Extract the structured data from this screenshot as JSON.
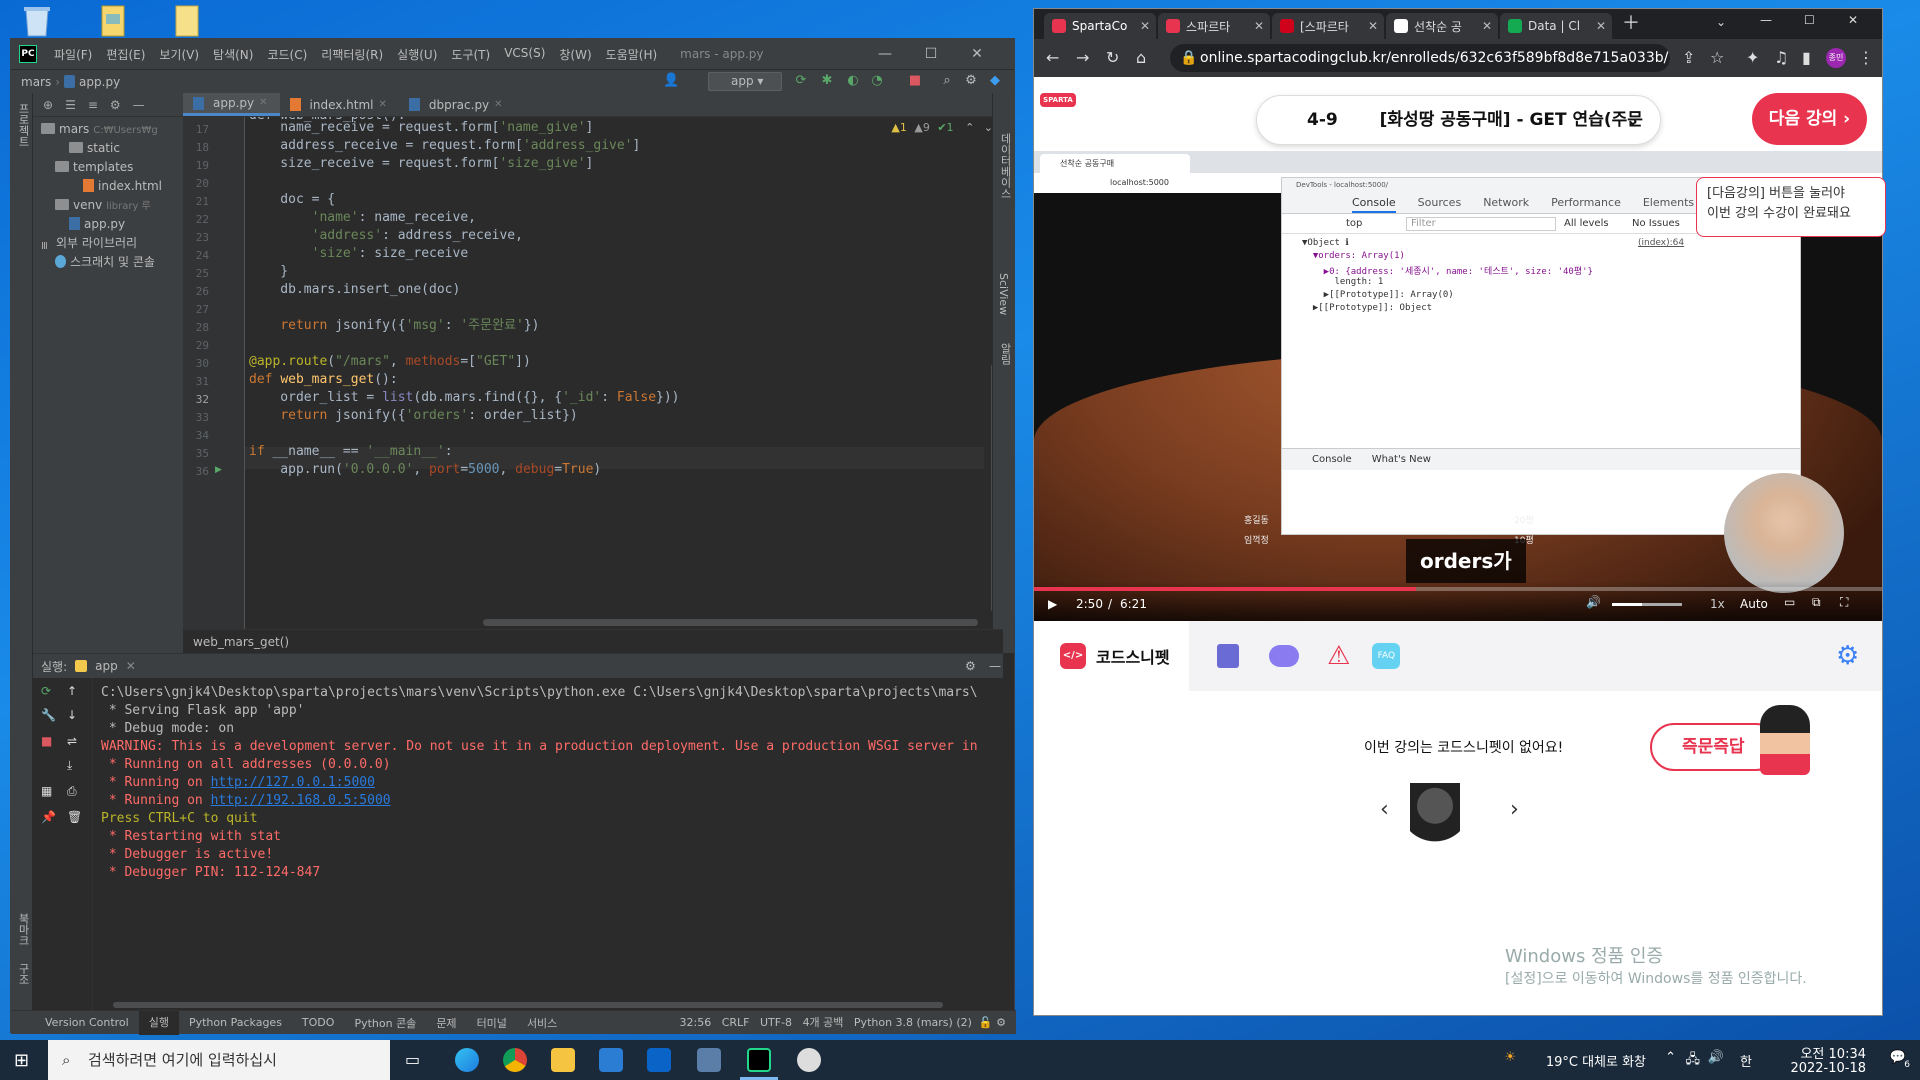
{
  "ide": {
    "title": "mars - app.py",
    "menu": [
      "파일(F)",
      "편집(E)",
      "보기(V)",
      "탐색(N)",
      "코드(C)",
      "리팩터링(R)",
      "실행(U)",
      "도구(T)",
      "VCS(S)",
      "창(W)",
      "도움말(H)"
    ],
    "breadcrumb_project": "mars",
    "breadcrumb_file": "app.py",
    "run_config": "app",
    "project_tree": [
      {
        "label": "mars",
        "hint": "C:₩Users₩g",
        "indent": 0,
        "type": "folder"
      },
      {
        "label": "static",
        "hint": "",
        "indent": 2,
        "type": "folder"
      },
      {
        "label": "templates",
        "hint": "",
        "indent": 1,
        "type": "folder"
      },
      {
        "label": "index.html",
        "hint": "",
        "indent": 3,
        "type": "html"
      },
      {
        "label": "venv",
        "hint": "library 루",
        "indent": 1,
        "type": "folder"
      },
      {
        "label": "app.py",
        "hint": "",
        "indent": 2,
        "type": "py"
      },
      {
        "label": "외부 라이브러리",
        "hint": "",
        "indent": 0,
        "type": "lib"
      },
      {
        "label": "스크래치 및 콘솔",
        "hint": "",
        "indent": 1,
        "type": "scratch"
      }
    ],
    "tabs": [
      {
        "label": "app.py",
        "active": true
      },
      {
        "label": "index.html",
        "active": false
      },
      {
        "label": "dbprac.py",
        "active": false
      }
    ],
    "warnings": {
      "warn": "▲1",
      "weak": "▲9",
      "ok": "✔1"
    },
    "line_numbers": [
      "17",
      "18",
      "19",
      "20",
      "21",
      "22",
      "23",
      "24",
      "25",
      "26",
      "27",
      "28",
      "29",
      "30",
      "31",
      "32",
      "33",
      "34",
      "35",
      "36"
    ],
    "code_top_partial": "def web_mars_post():",
    "code_lines": [
      "    name_receive = request.form['name_give']",
      "    address_receive = request.form['address_give']",
      "    size_receive = request.form['size_give']",
      "",
      "    doc = {",
      "        'name': name_receive,",
      "        'address': address_receive,",
      "        'size': size_receive",
      "    }",
      "    db.mars.insert_one(doc)",
      "",
      "    return jsonify({'msg': '주문완료'})",
      "",
      "@app.route(\"/mars\", methods=[\"GET\"])",
      "def web_mars_get():",
      "    order_list = list(db.mars.find({}, {'_id': False}))",
      "    return jsonify({'orders': order_list})",
      "",
      "if __name__ == '__main__':",
      "    app.run('0.0.0.0', port=5000, debug=True)"
    ],
    "editor_breadcrumb": "web_mars_get()",
    "run_label": "실행:",
    "run_tab": "app",
    "console_lines": [
      {
        "text": "C:\\Users\\gnjk4\\Desktop\\sparta\\projects\\mars\\venv\\Scripts\\python.exe C:\\Users\\gnjk4\\Desktop\\sparta\\projects\\mars\\",
        "style": "white"
      },
      {
        "text": " * Serving Flask app 'app'",
        "style": "white"
      },
      {
        "text": " * Debug mode: on",
        "style": "white"
      },
      {
        "text": "WARNING: This is a development server. Do not use it in a production deployment. Use a production WSGI server in",
        "style": "red"
      },
      {
        "text": " * Running on all addresses (0.0.0.0)",
        "style": "red"
      },
      {
        "text": " * Running on ",
        "style": "red",
        "link": "http://127.0.0.1:5000"
      },
      {
        "text": " * Running on ",
        "style": "red",
        "link": "http://192.168.0.5:5000"
      },
      {
        "text": "Press CTRL+C to quit",
        "style": "yellow"
      },
      {
        "text": " * Restarting with stat",
        "style": "red"
      },
      {
        "text": " * Debugger is active!",
        "style": "red"
      },
      {
        "text": " * Debugger PIN: 112-124-847",
        "style": "red"
      }
    ],
    "bottom_tabs": [
      "Version Control",
      "실행",
      "Python Packages",
      "TODO",
      "Python 콘솔",
      "문제",
      "터미널",
      "서비스"
    ],
    "status": {
      "position": "32:56",
      "line_sep": "CRLF",
      "encoding": "UTF-8",
      "indent": "4개 공백",
      "interpreter": "Python 3.8 (mars) (2)"
    }
  },
  "browser": {
    "tabs": [
      {
        "label": "SpartaCo",
        "color": "#e8344e"
      },
      {
        "label": "스파르타",
        "color": "#e8344e"
      },
      {
        "label": "[스파르타",
        "color": "#d0021b"
      },
      {
        "label": "선착순 공",
        "color": "#ffffff"
      },
      {
        "label": "Data | Cl",
        "color": "#13aa52"
      }
    ],
    "url": "online.spartacodingclub.kr/enrolleds/632c63f589bf8d8e715a033b/...",
    "profile": "종민",
    "logo_text": "SPARTA",
    "lesson_number": "4-9",
    "lesson_title": "[화성땅 공동구매] - GET 연습(주문",
    "next_button": "다음 강의",
    "tooltip_line1": "[다음강의] 버튼을 눌러야",
    "tooltip_line2": "이번 강의 수강이 완료돼요",
    "video": {
      "inner_tab": "선착순 공동구매",
      "inner_url": "localhost:5000",
      "devtools_title": "DevTools - localhost:5000/",
      "devtools_tabs": [
        "Console",
        "Sources",
        "Network",
        "Performance",
        "Elements"
      ],
      "context": "top",
      "filter_placeholder": "Filter",
      "levels": "All levels",
      "issues": "No Issues",
      "obj_lines": [
        "▼Object ℹ",
        "  ▼orders: Array(1)",
        "    ▶0: {address: '세종시', name: '테스트', size: '40평'}",
        "      length: 1",
        "    ▶[[Prototype]]: Array(0)",
        "  ▶[[Prototype]]: Object"
      ],
      "source_link": "(index):64",
      "drawer_tabs": [
        "Console",
        "What's New"
      ],
      "table_rows": [
        [
          "홍길동",
          "20평"
        ],
        [
          "임꺽정",
          "10평"
        ]
      ],
      "subtitle": "orders가",
      "time_current": "2:50",
      "time_total": "6:21",
      "speed": "1x",
      "quality": "Auto",
      "progress": 0.45
    },
    "snippet_tab": "코드스니펫",
    "snippet_msg": "이번 강의는 코드스니펫이 없어요!",
    "instant_button": "즉문즉답",
    "faq": "FAQ",
    "watermark_title": "Windows 정품 인증",
    "watermark_sub": "[설정]으로 이동하여 Windows를 정품 인증합니다."
  },
  "taskbar": {
    "search_placeholder": "검색하려면 여기에 입력하십시",
    "weather": "19°C  대체로 화창",
    "ime": "한",
    "time": "오전 10:34",
    "date": "2022-10-18",
    "notif_count": "6"
  }
}
